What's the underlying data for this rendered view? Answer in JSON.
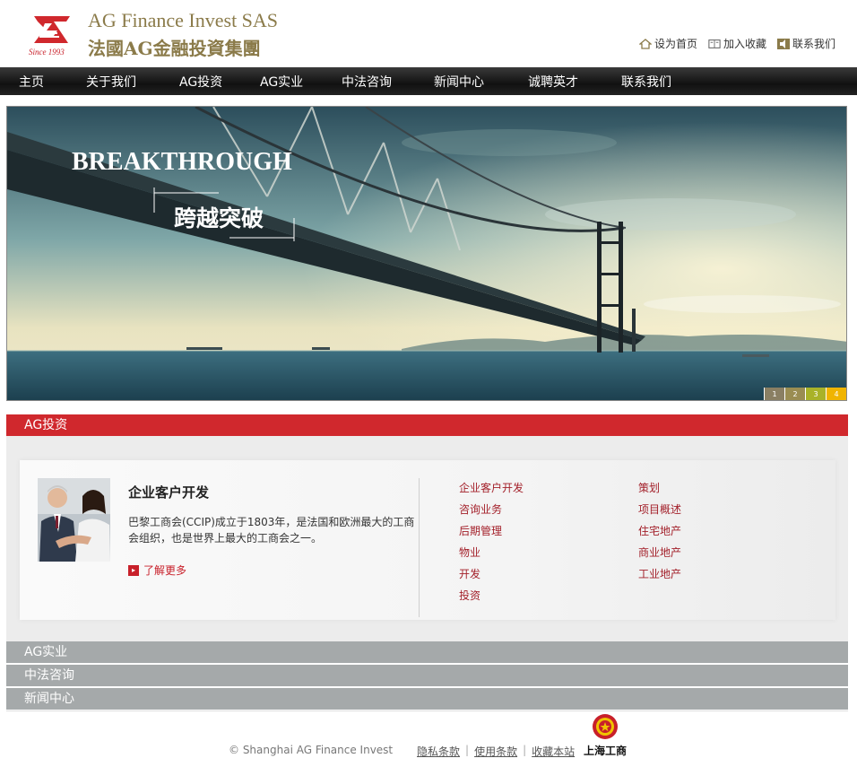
{
  "header": {
    "logo_en": "AG Finance Invest SAS",
    "logo_cn": "法國AG金融投資集團",
    "logo_since": "Since 1993",
    "toplinks": {
      "home": "设为首页",
      "favorite": "加入收藏",
      "contact": "联系我们"
    }
  },
  "nav": [
    "主页",
    "关于我们",
    "AG投资",
    "AG实业",
    "中法咨询",
    "新闻中心",
    "诚聘英才",
    "联系我们"
  ],
  "banner": {
    "title_en": "BREAKTHROUGH",
    "title_cn": "跨越突破",
    "pages": [
      "1",
      "2",
      "3",
      "4"
    ],
    "active_page": "4"
  },
  "sections": {
    "active": "AG投资",
    "collapsed": [
      "AG实业",
      "中法咨询",
      "新闻中心"
    ]
  },
  "feature": {
    "title": "企业客户开发",
    "desc": "巴黎工商会(CCIP)成立于1803年，是法国和欧洲最大的工商会组织，也是世界上最大的工商会之一。",
    "more": "了解更多"
  },
  "links_left": [
    "企业客户开发",
    "咨询业务",
    "后期管理",
    "物业",
    "开发",
    "投资"
  ],
  "links_right": [
    "策划",
    "项目概述",
    "住宅地产",
    "商业地产",
    "工业地产"
  ],
  "footer": {
    "copyright": "© Shanghai AG Finance Invest",
    "links": [
      "隐私条款",
      "使用条款",
      "收藏本站"
    ],
    "gongshang": "上海工商"
  },
  "colors": {
    "accent_red": "#d0282d",
    "link_red": "#a3202a",
    "nav_bg": "#1a1a1a",
    "section_grey": "#a5a9aa",
    "logo_gold": "#8b7b4a"
  }
}
